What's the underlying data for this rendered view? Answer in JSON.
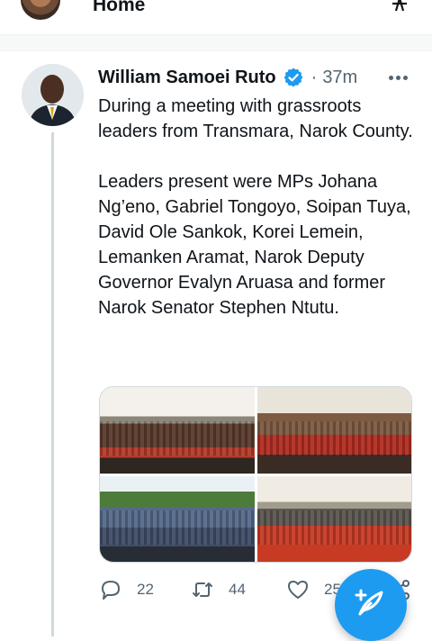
{
  "header": {
    "title": "Home",
    "icons": [
      "avatar",
      "sparkle-icon"
    ]
  },
  "tweet": {
    "author": "William Samoei Ruto",
    "verified": true,
    "separator": "·",
    "time": "37m",
    "paragraphs": [
      "During a meeting with grassroots leaders from Transmara, Narok County.",
      "Leaders present were MPs Johana Ng’eno, Gabriel Tongoyo, Soipan Tuya, David Ole Sankok, Korei Lemein, Lemanken Aramat, Narok Deputy Governor Evalyn Aruasa and former Narok Senator Stephen Ntutu."
    ],
    "stats": {
      "replies": "22",
      "retweets": "44",
      "likes": "25"
    }
  },
  "colors": {
    "accent": "#1d9bf0",
    "text": "#0f1419",
    "muted": "#536471"
  }
}
